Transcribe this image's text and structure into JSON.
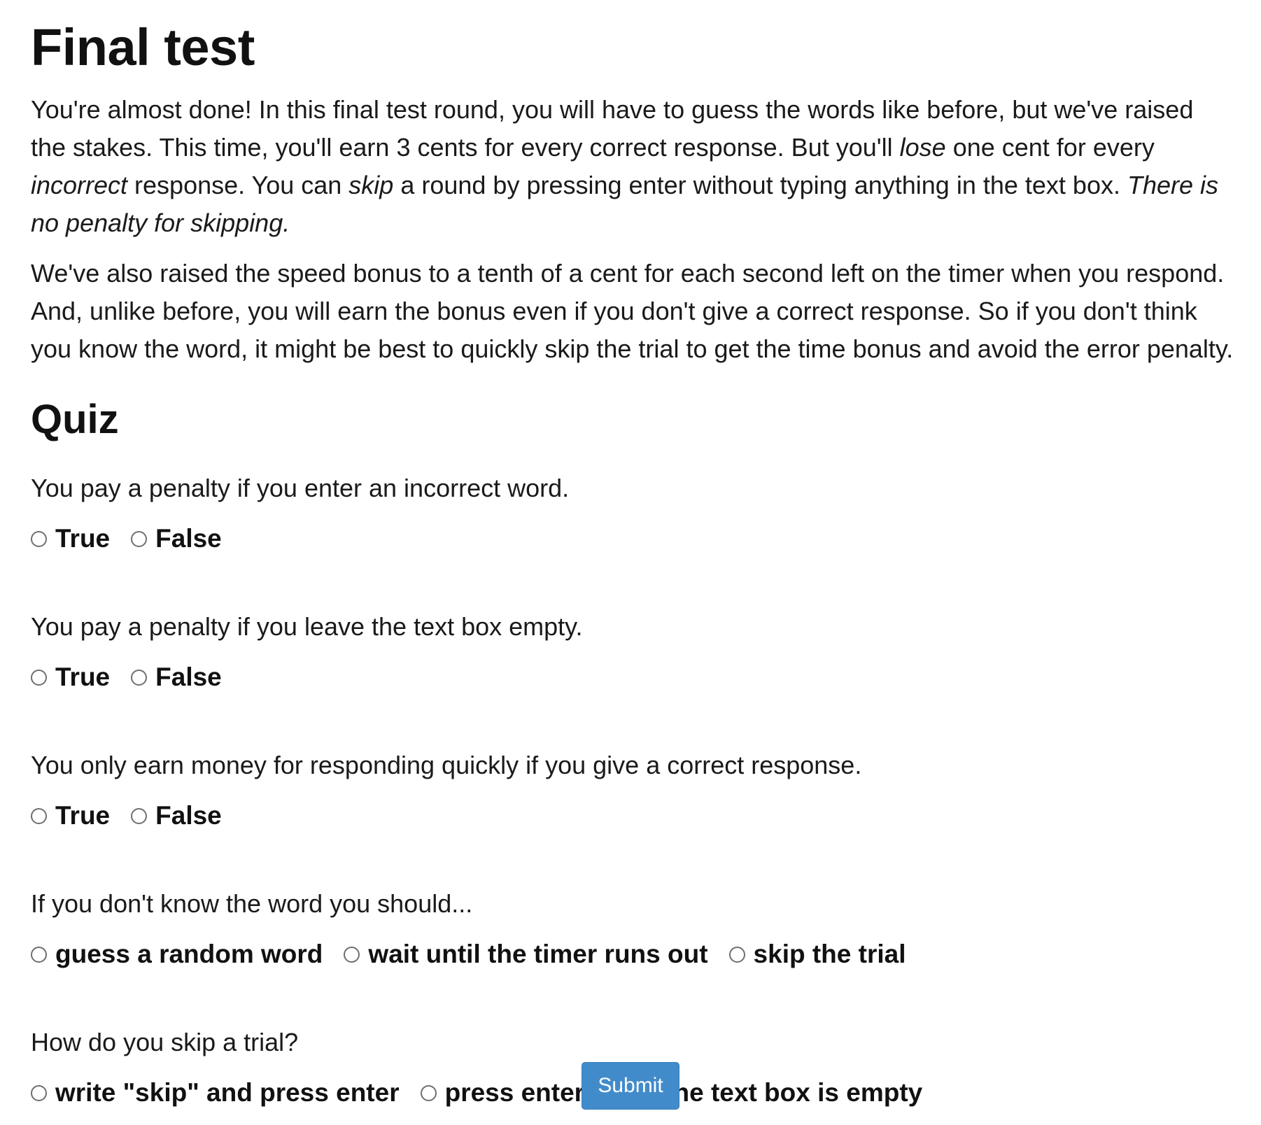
{
  "title": "Final test",
  "intro": {
    "p1": {
      "s1": "You're almost done! In this final test round, you will have to guess the words like before, but we've raised the stakes. This time, you'll earn 3 cents for every correct response. But you'll ",
      "e1": "lose",
      "s2": " one cent for every ",
      "e2": "incorrect",
      "s3": " response. You can ",
      "e3": "skip",
      "s4": " a round by pressing enter without typing anything in the text box. ",
      "e4": "There is no penalty for skipping."
    },
    "p2": "We've also raised the speed bonus to a tenth of a cent for each second left on the timer when you respond. And, unlike before, you will earn the bonus even if you don't give a correct response. So if you don't think you know the word, it might be best to quickly skip the trial to get the time bonus and avoid the error penalty."
  },
  "quiz": {
    "heading": "Quiz",
    "questions": [
      {
        "text": "You pay a penalty if you enter an incorrect word.",
        "options": [
          "True",
          "False"
        ]
      },
      {
        "text": "You pay a penalty if you leave the text box empty.",
        "options": [
          "True",
          "False"
        ]
      },
      {
        "text": "You only earn money for responding quickly if you give a correct response.",
        "options": [
          "True",
          "False"
        ]
      },
      {
        "text": "If you don't know the word you should...",
        "options": [
          "guess a random word",
          "wait until the timer runs out",
          "skip the trial"
        ]
      },
      {
        "text": "How do you skip a trial?",
        "options": [
          "write \"skip\" and press enter",
          "press enter when the text box is empty"
        ]
      }
    ]
  },
  "submit_label": "Submit",
  "colors": {
    "submit_bg": "#428bca",
    "text": "#111111"
  }
}
